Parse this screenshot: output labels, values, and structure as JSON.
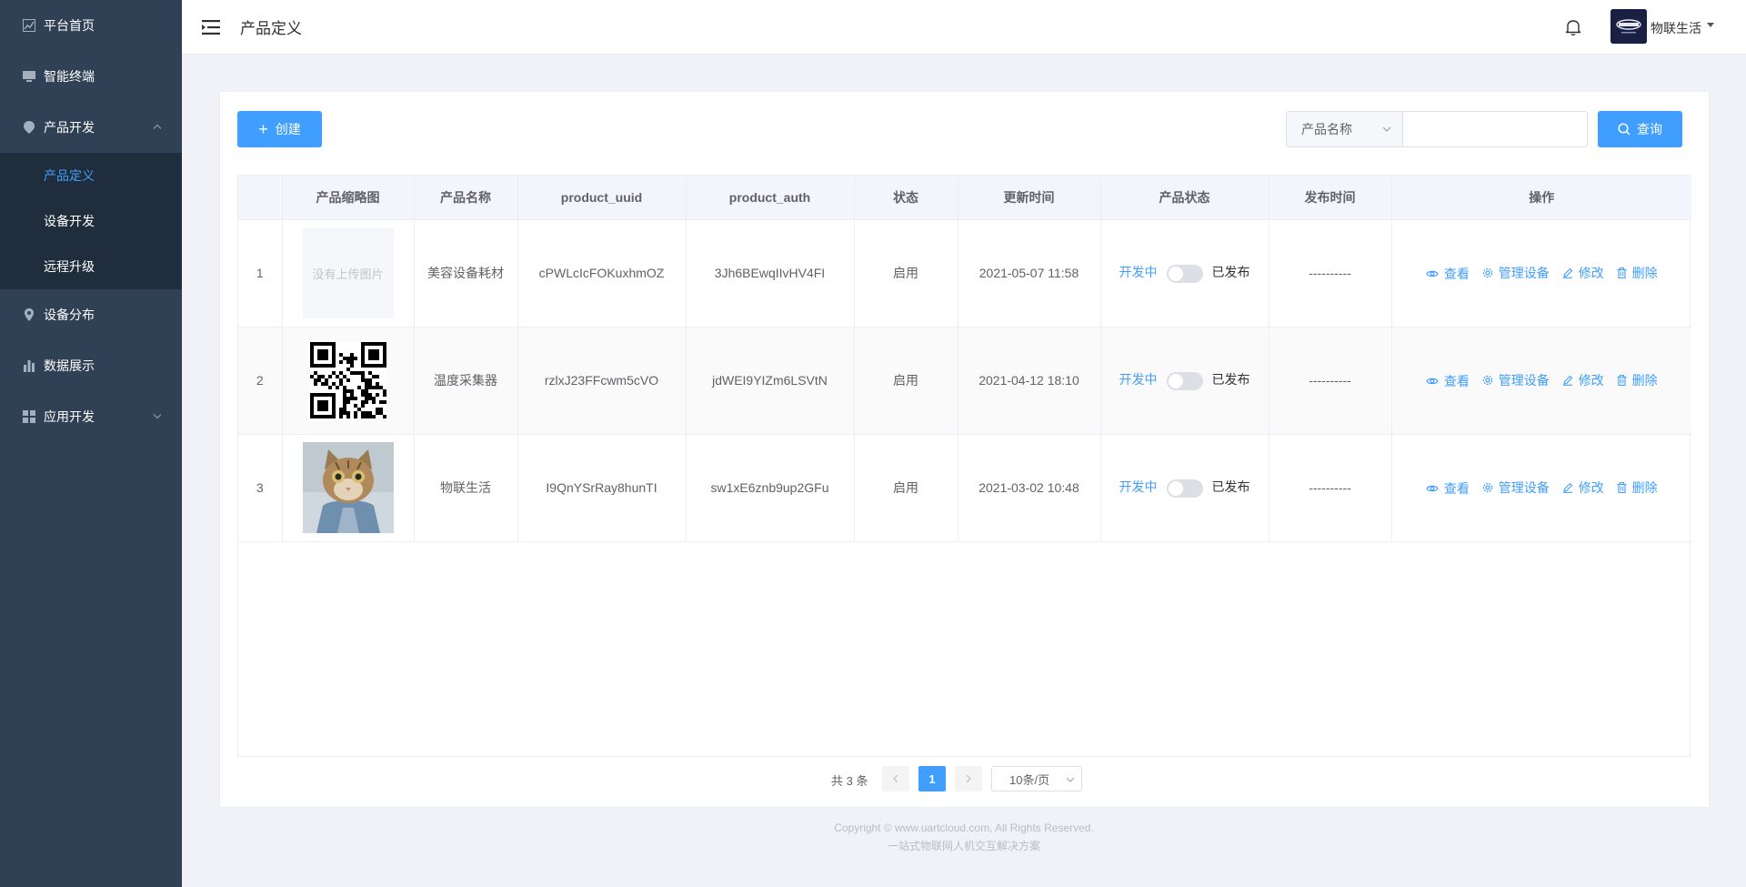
{
  "sidebar": {
    "items": [
      {
        "label": "平台首页",
        "icon": "chart-line-icon"
      },
      {
        "label": "智能终端",
        "icon": "monitor-icon"
      },
      {
        "label": "产品开发",
        "icon": "pin-icon",
        "expanded": true,
        "children": [
          {
            "label": "产品定义",
            "active": true
          },
          {
            "label": "设备开发"
          },
          {
            "label": "远程升级"
          }
        ]
      },
      {
        "label": "设备分布",
        "icon": "location-icon"
      },
      {
        "label": "数据展示",
        "icon": "bar-chart-icon"
      },
      {
        "label": "应用开发",
        "icon": "grid-icon",
        "expanded": false
      }
    ]
  },
  "header": {
    "title": "产品定义",
    "user_name": "物联生活"
  },
  "toolbar": {
    "create_label": "创建",
    "search_select_value": "产品名称",
    "search_input_value": "",
    "search_label": "查询"
  },
  "table": {
    "columns": [
      "",
      "产品缩略图",
      "产品名称",
      "product_uuid",
      "product_auth",
      "状态",
      "更新时间",
      "产品状态",
      "发布时间",
      "操作"
    ],
    "no_image_text": "没有上传图片",
    "rows": [
      {
        "index": "1",
        "thumb": "empty",
        "name": "美容设备耗材",
        "uuid": "cPWLcIcFOKuxhmOZ",
        "auth": "3Jh6BEwqIIvHV4FI",
        "status": "启用",
        "updated": "2021-05-07 11:58",
        "dev_label": "开发中",
        "pub_label": "已发布",
        "published_at": "----------"
      },
      {
        "index": "2",
        "thumb": "qr",
        "name": "温度采集器",
        "uuid": "rzlxJ23FFcwm5cVO",
        "auth": "jdWEI9YIZm6LSVtN",
        "status": "启用",
        "updated": "2021-04-12 18:10",
        "dev_label": "开发中",
        "pub_label": "已发布",
        "published_at": "----------"
      },
      {
        "index": "3",
        "thumb": "cat",
        "name": "物联生活",
        "uuid": "I9QnYSrRay8hunTI",
        "auth": "sw1xE6znb9up2GFu",
        "status": "启用",
        "updated": "2021-03-02 10:48",
        "dev_label": "开发中",
        "pub_label": "已发布",
        "published_at": "----------"
      }
    ],
    "actions": {
      "view": "查看",
      "manage": "管理设备",
      "edit": "修改",
      "delete": "删除"
    }
  },
  "pagination": {
    "total_label": "共 3 条",
    "current_page": "1",
    "page_size_label": "10条/页"
  },
  "footer": {
    "copyright": "Copyright © www.uartcloud.com, All Rights Reserved.",
    "slogan": "一站式物联网人机交互解决方案"
  },
  "colors": {
    "sidebar_bg": "#304156",
    "submenu_bg": "#1f2d3d",
    "accent": "#409eff"
  }
}
